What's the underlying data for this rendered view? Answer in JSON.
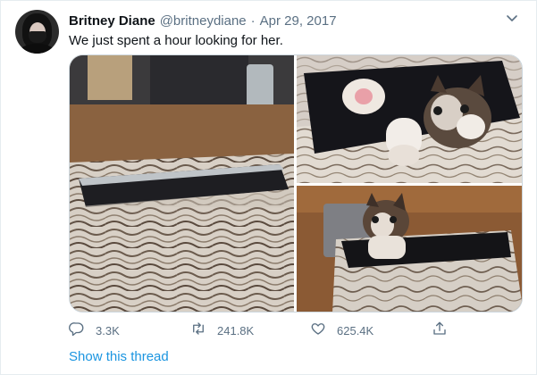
{
  "tweet": {
    "author_name": "Britney Diane",
    "handle": "@britneydiane",
    "separator": "·",
    "date": "Apr 29, 2017",
    "text": "We just spent a hour looking for her.",
    "photo_count": 3
  },
  "actions": {
    "replies": "3.3K",
    "retweets": "241.8K",
    "likes": "625.4K"
  },
  "thread_link": "Show this thread",
  "icons": {
    "more": "chevron-down-icon",
    "reply": "reply-icon",
    "retweet": "retweet-icon",
    "like": "heart-icon",
    "share": "share-icon"
  },
  "colors": {
    "link": "#1b95e0",
    "secondary_text": "#5b7083",
    "border": "#e6ecf0"
  }
}
